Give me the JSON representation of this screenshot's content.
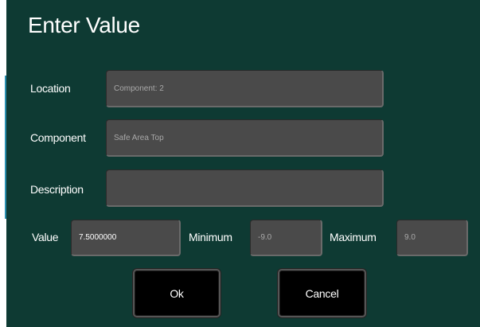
{
  "dialog": {
    "title": "Enter Value"
  },
  "location": {
    "label": "Location",
    "value": "Component: 2"
  },
  "component": {
    "label": "Component",
    "value": "Safe Area Top"
  },
  "description": {
    "label": "Description",
    "value": ""
  },
  "value": {
    "label": "Value",
    "value": "7.5000000"
  },
  "minimum": {
    "label": "Minimum",
    "value": "-9.0"
  },
  "maximum": {
    "label": "Maximum",
    "value": "9.0"
  },
  "buttons": {
    "ok": "Ok",
    "cancel": "Cancel"
  },
  "colors": {
    "dialog_background": "#0e3a33",
    "field_background": "#4a4a4a",
    "button_background": "#000000"
  }
}
